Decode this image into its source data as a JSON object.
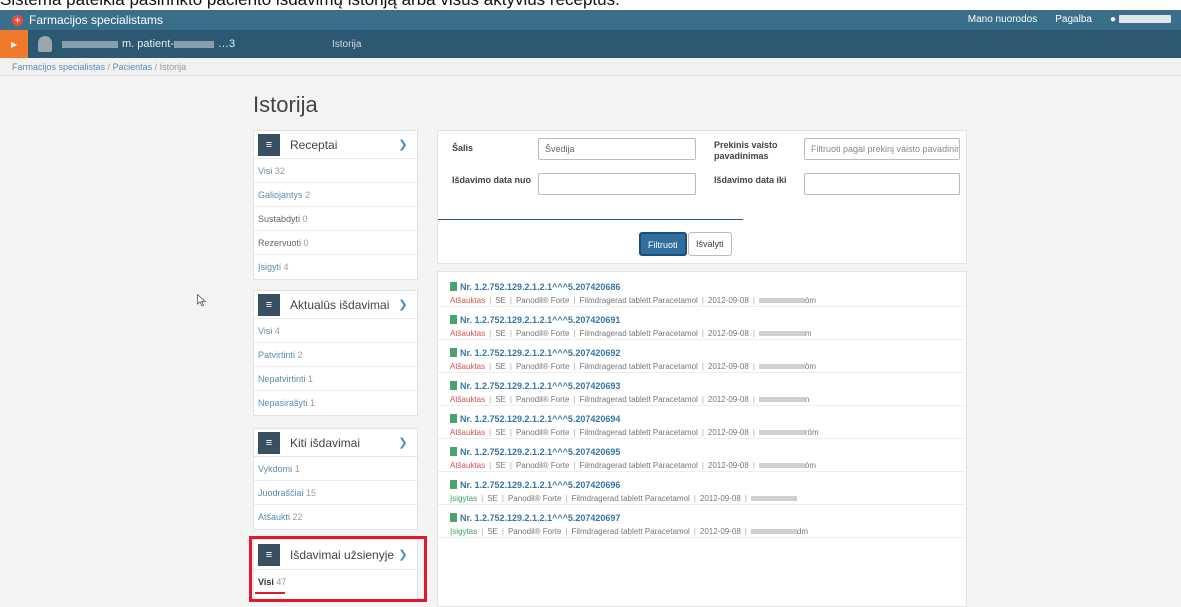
{
  "caption": "Sistema pateikia pasirinkto paciento išdavimų istoriją arba visus aktyvius receptus.",
  "topbar": {
    "brand": "Farmacijos specialistams",
    "links": [
      "Mano nuorodos",
      "Pagalba"
    ]
  },
  "patientbar": {
    "name_suffix": "m. patient-",
    "name_id": "…3",
    "section": "Istorija"
  },
  "breadcrumb": [
    "Farmacijos specialistas",
    "Pacientas",
    "Istorija"
  ],
  "page_title": "Istorija",
  "sidebar": {
    "panels": [
      {
        "title": "Receptai",
        "items": [
          {
            "label": "Visi",
            "count": "32"
          },
          {
            "label": "Galiojantys",
            "count": "2"
          },
          {
            "label": "Sustabdyti",
            "count": "0"
          },
          {
            "label": "Rezervuoti",
            "count": "0"
          },
          {
            "label": "Įsigyti",
            "count": "4"
          }
        ]
      },
      {
        "title": "Aktualūs išdavimai",
        "items": [
          {
            "label": "Visi",
            "count": "4"
          },
          {
            "label": "Patvirtinti",
            "count": "2"
          },
          {
            "label": "Nepatvirtinti",
            "count": "1"
          },
          {
            "label": "Nepasirašyti",
            "count": "1"
          }
        ]
      },
      {
        "title": "Kiti išdavimai",
        "items": [
          {
            "label": "Vykdomi",
            "count": "1"
          },
          {
            "label": "Juodraščiai",
            "count": "15"
          },
          {
            "label": "Atšaukti",
            "count": "22"
          }
        ]
      },
      {
        "title": "Išdavimai užsienyje",
        "items": [
          {
            "label": "Visi",
            "count": "47"
          }
        ]
      }
    ]
  },
  "filters": {
    "country_label": "Šalis",
    "country_value": "Švedija",
    "trade_name_label": "Prekinis vaisto pavadinimas",
    "trade_name_placeholder": "Filtruoti pagal prekinį vaisto pavadinimą",
    "date_from_label": "Išdavimo data nuo",
    "date_from_value": "",
    "date_to_label": "Išdavimo data iki",
    "date_to_value": "",
    "filter_button": "Filtruoti",
    "clear_button": "Išvalyti"
  },
  "results": [
    {
      "nr": "Nr. 1.2.752.129.2.1.2.1^^^5.207420686",
      "status": "Atšauktas",
      "status_type": "cancel",
      "country": "SE",
      "product": "Panodil® Forte",
      "form": "Filmdragerad tablett Paracetamol",
      "date": "2012-09-08",
      "author_tail": "öm"
    },
    {
      "nr": "Nr. 1.2.752.129.2.1.2.1^^^5.207420691",
      "status": "Atšauktas",
      "status_type": "cancel",
      "country": "SE",
      "product": "Panodil® Forte",
      "form": "Filmdragerad tablett Paracetamol",
      "date": "2012-09-08",
      "author_tail": "m"
    },
    {
      "nr": "Nr. 1.2.752.129.2.1.2.1^^^5.207420692",
      "status": "Atšauktas",
      "status_type": "cancel",
      "country": "SE",
      "product": "Panodil® Forte",
      "form": "Filmdragerad tablett Paracetamol",
      "date": "2012-09-08",
      "author_tail": "öm"
    },
    {
      "nr": "Nr. 1.2.752.129.2.1.2.1^^^5.207420693",
      "status": "Atšauktas",
      "status_type": "cancel",
      "country": "SE",
      "product": "Panodil® Forte",
      "form": "Filmdragerad tablett Paracetamol",
      "date": "2012-09-08",
      "author_tail": "n"
    },
    {
      "nr": "Nr. 1.2.752.129.2.1.2.1^^^5.207420694",
      "status": "Atšauktas",
      "status_type": "cancel",
      "country": "SE",
      "product": "Panodil® Forte",
      "form": "Filmdragerad tablett Paracetamol",
      "date": "2012-09-08",
      "author_tail": "röm"
    },
    {
      "nr": "Nr. 1.2.752.129.2.1.2.1^^^5.207420695",
      "status": "Atšauktas",
      "status_type": "cancel",
      "country": "SE",
      "product": "Panodil® Forte",
      "form": "Filmdragerad tablett Paracetamol",
      "date": "2012-09-08",
      "author_tail": "öm"
    },
    {
      "nr": "Nr. 1.2.752.129.2.1.2.1^^^5.207420696",
      "status": "Įsigytas",
      "status_type": "bought",
      "country": "SE",
      "product": "Panodil® Forte",
      "form": "Filmdragerad tablett Paracetamol",
      "date": "2012-09-08",
      "author_tail": ""
    },
    {
      "nr": "Nr. 1.2.752.129.2.1.2.1^^^5.207420697",
      "status": "Įsigytas",
      "status_type": "bought",
      "country": "SE",
      "product": "Panodil® Forte",
      "form": "Filmdragerad tablett Paracetamol",
      "date": "2012-09-08",
      "author_tail": "dm"
    }
  ],
  "colors": {
    "topbar": "#3a6f8c",
    "patientbar": "#2c5872",
    "accent_orange": "#f07a2a",
    "link_blue": "#3576a8",
    "cancel_red": "#d9534f",
    "bought_green": "#3aa36a",
    "highlight_red": "#e0192e"
  }
}
